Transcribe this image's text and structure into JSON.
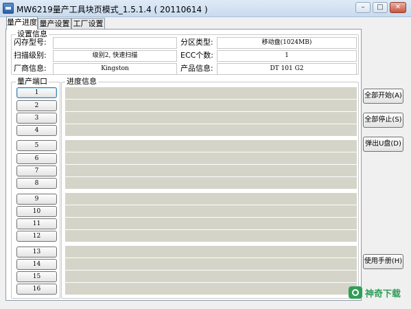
{
  "window": {
    "title": "MW6219量产工具块页模式_1.5.1.4 ( 20110614 )",
    "caption_buttons": {
      "minimize": "–",
      "maximize": "□",
      "close": "✕"
    }
  },
  "tabs": [
    "量产进度",
    "量产设置",
    "工厂设置"
  ],
  "settings": {
    "group_title": "设置信息",
    "flash_model_label": "闪存型号:",
    "flash_model_value": "",
    "partition_type_label": "分区类型:",
    "partition_type_value": "移动盘(1024MB)",
    "scan_level_label": "扫描级别:",
    "scan_level_value": "级别2, 快速扫描",
    "ecc_label": "ECC个数:",
    "ecc_value": "1",
    "vendor_label": "厂商信息:",
    "vendor_value": "Kingston",
    "product_label": "产品信息:",
    "product_value": "DT 101 G2"
  },
  "ports": {
    "group_title": "量产端口",
    "labels": [
      "1",
      "2",
      "3",
      "4",
      "5",
      "6",
      "7",
      "8",
      "9",
      "10",
      "11",
      "12",
      "13",
      "14",
      "15",
      "16"
    ]
  },
  "progress": {
    "group_title": "进度信息"
  },
  "actions": {
    "start_all": "全部开始(A)",
    "stop_all": "全部停止(S)",
    "eject": "弹出U盘(D)",
    "manual": "使用手册(H)"
  },
  "watermark": {
    "text": "神奇下载"
  },
  "colors": {
    "progress_bar": "#d4d4c8",
    "panel": "#ffffff",
    "watermark": "#2f9e57"
  }
}
